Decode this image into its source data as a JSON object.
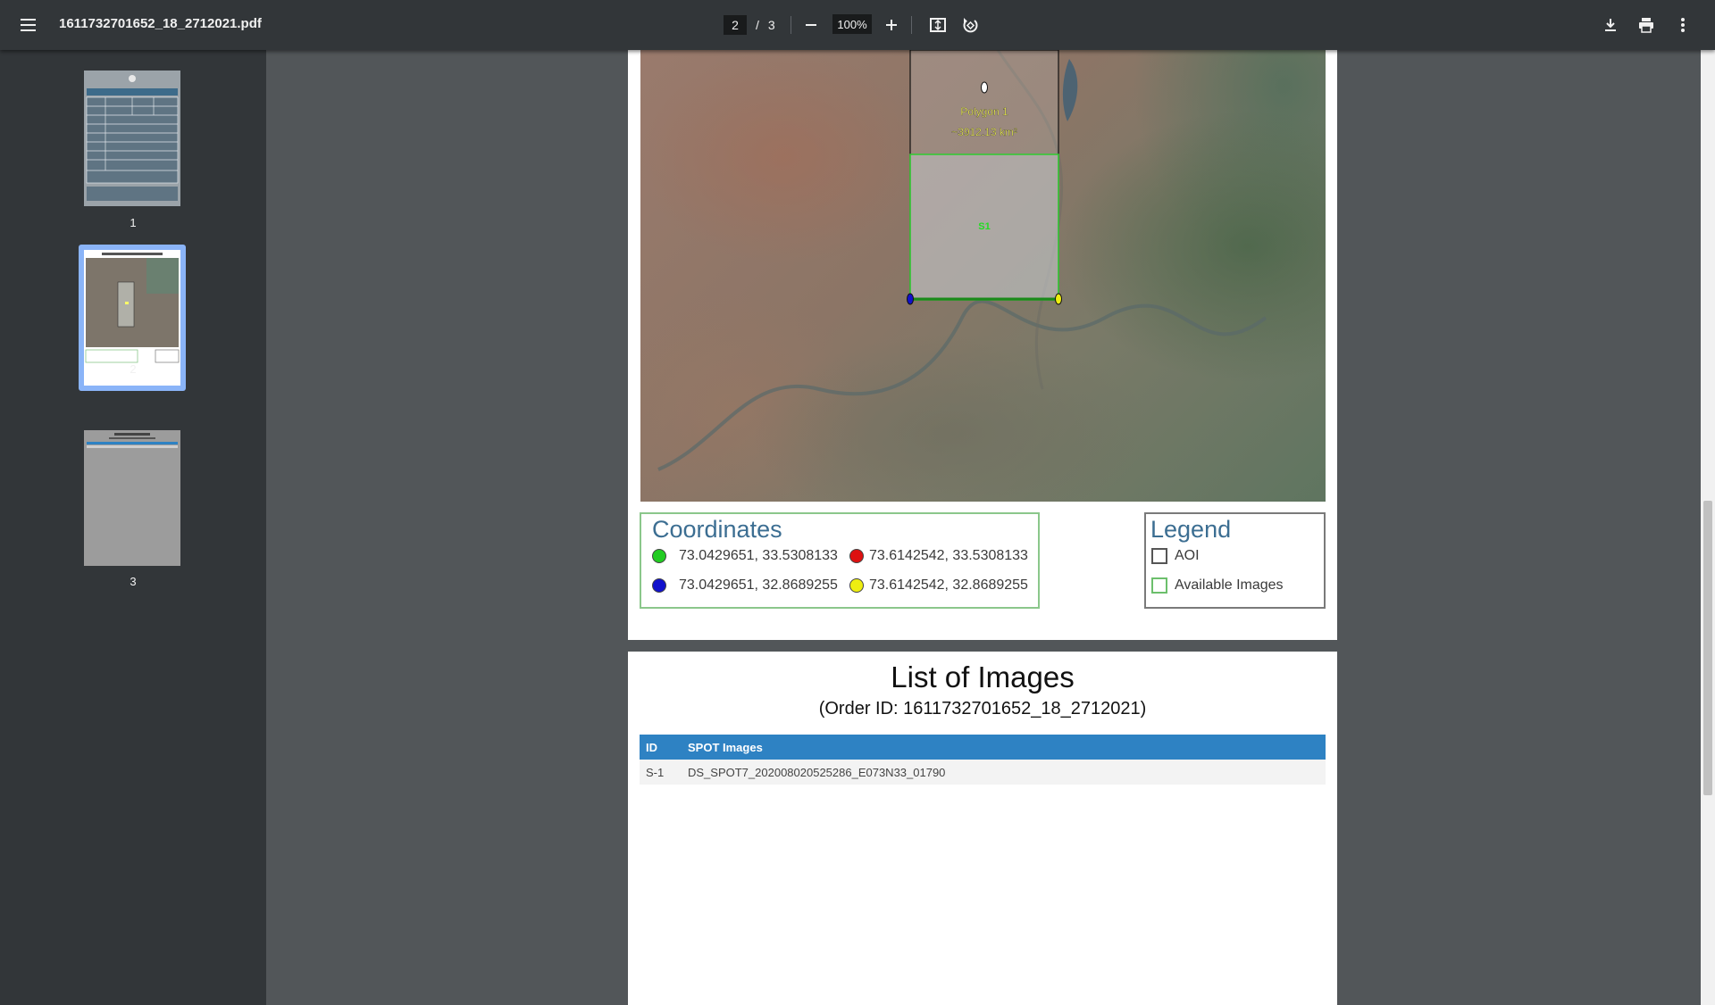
{
  "toolbar": {
    "file_name": "1611732701652_18_2712021.pdf",
    "current_page": "2",
    "page_separator": "/",
    "total_pages": "3",
    "zoom": "100%"
  },
  "sidebar": {
    "thumbnails": [
      {
        "label": "1"
      },
      {
        "label": "2",
        "selected": true
      },
      {
        "label": "3"
      }
    ]
  },
  "map": {
    "polygon_label": "Polygon 1",
    "polygon_area": "~3912.13 km²",
    "scene_label": "S1"
  },
  "coordinates": {
    "title": "Coordinates",
    "points": [
      {
        "text": "73.0429651, 33.5308133",
        "color": "#22cc22"
      },
      {
        "text": "73.6142542, 33.5308133",
        "color": "#dd1111"
      },
      {
        "text": "73.0429651, 32.8689255",
        "color": "#1111cc"
      },
      {
        "text": "73.6142542, 32.8689255",
        "color": "#eeee11"
      }
    ]
  },
  "legend": {
    "title": "Legend",
    "items": [
      {
        "label": "AOI",
        "color": "#555555"
      },
      {
        "label": "Available Images",
        "color": "#6cbf6c"
      }
    ]
  },
  "images_page": {
    "title": "List of Images",
    "subtitle": "(Order ID: 1611732701652_18_2712021)",
    "columns": [
      "ID",
      "SPOT Images"
    ],
    "rows": [
      [
        "S-1",
        "DS_SPOT7_202008020525286_E073N33_01790"
      ]
    ],
    "header_color": "#2e82c3"
  }
}
